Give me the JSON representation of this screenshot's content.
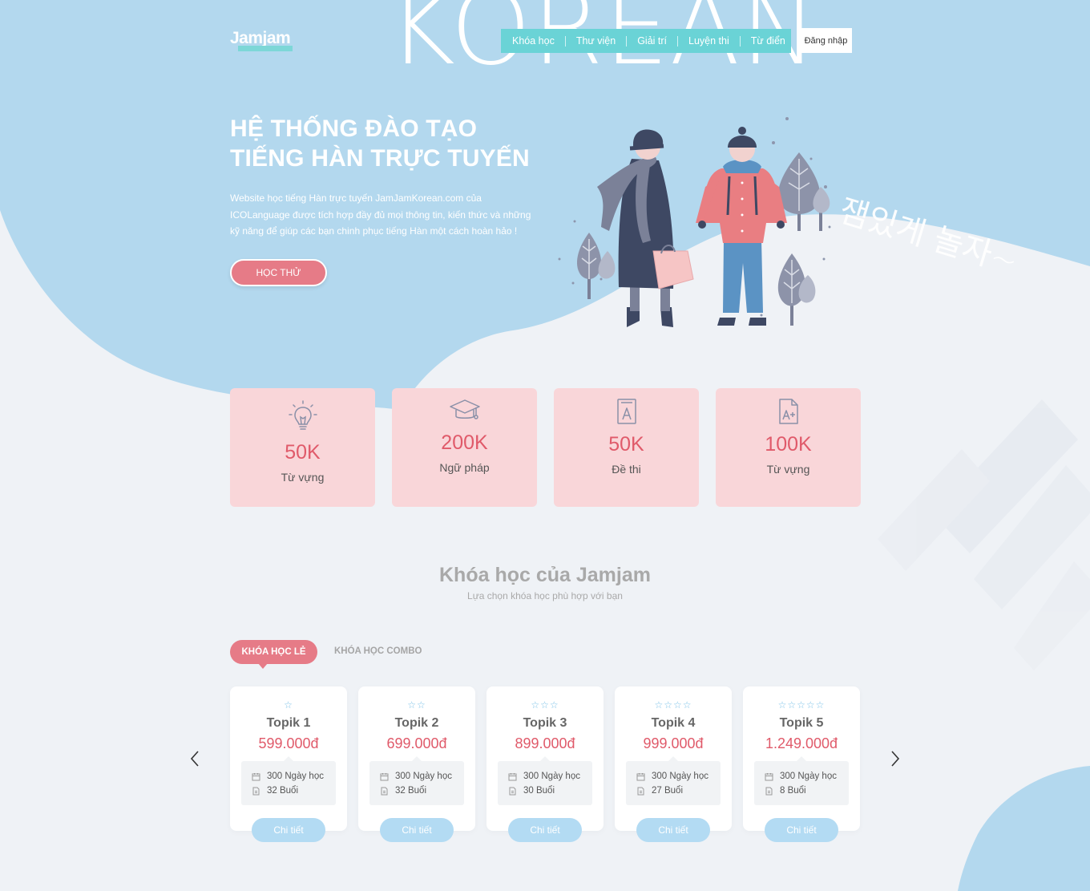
{
  "header": {
    "logo_text": "Jamjam",
    "decor_text": "KOREAN",
    "nav": [
      "Khóa học",
      "Thư viện",
      "Giải trí",
      "Luyện thi",
      "Từ điển"
    ],
    "login_label": "Đăng nhập"
  },
  "hero": {
    "title_line1": "HỆ THỐNG ĐÀO TẠO",
    "title_line2": "TIẾNG HÀN TRỰC TUYẾN",
    "desc_line1": "Website học tiếng Hàn trực tuyến JamJamKorean.com của",
    "desc_line2": "ICOLanguage được tích hợp đầy đủ mọi thông tin, kiến thức và những",
    "desc_line3": "kỹ năng để giúp các bạn chinh phục tiếng Hàn một cách hoàn hảo !",
    "cta_label": "HỌC THỬ",
    "korean_script": "잼있게 놀자~"
  },
  "stats": [
    {
      "icon": "lightbulb-icon",
      "number": "50K",
      "label": "Từ vựng"
    },
    {
      "icon": "graduation-cap-icon",
      "number": "200K",
      "label": "Ngữ pháp"
    },
    {
      "icon": "book-icon",
      "number": "50K",
      "label": "Đề thi"
    },
    {
      "icon": "exam-grade-icon",
      "number": "100K",
      "label": "Từ vựng"
    }
  ],
  "courses_section": {
    "title": "Khóa học của Jamjam",
    "subtitle": "Lựa chọn khóa học phù hợp với bạn",
    "tab_single": "KHÓA HỌC LẺ",
    "tab_combo": "KHÓA HỌC COMBO",
    "courses": [
      {
        "stars": "☆",
        "name": "Topik 1",
        "price": "599.000đ",
        "days": "300 Ngày học",
        "sessions": "32 Buổi",
        "button": "Chi tiết"
      },
      {
        "stars": "☆☆",
        "name": "Topik 2",
        "price": "699.000đ",
        "days": "300 Ngày học",
        "sessions": "32 Buổi",
        "button": "Chi tiết"
      },
      {
        "stars": "☆☆☆",
        "name": "Topik 3",
        "price": "899.000đ",
        "days": "300 Ngày học",
        "sessions": "30 Buổi",
        "button": "Chi tiết"
      },
      {
        "stars": "☆☆☆☆",
        "name": "Topik 4",
        "price": "999.000đ",
        "days": "300 Ngày học",
        "sessions": "27 Buổi",
        "button": "Chi tiết"
      },
      {
        "stars": "☆☆☆☆☆",
        "name": "Topik 5",
        "price": "1.249.000đ",
        "days": "300 Ngày học",
        "sessions": "8 Buổi",
        "button": "Chi tiết"
      }
    ]
  },
  "colors": {
    "sky": "#b3d8ee",
    "background": "#eff2f6",
    "pink_accent": "#e67b87",
    "card_pink": "#f9d6d9",
    "teal_nav": "#6ad3d6"
  }
}
